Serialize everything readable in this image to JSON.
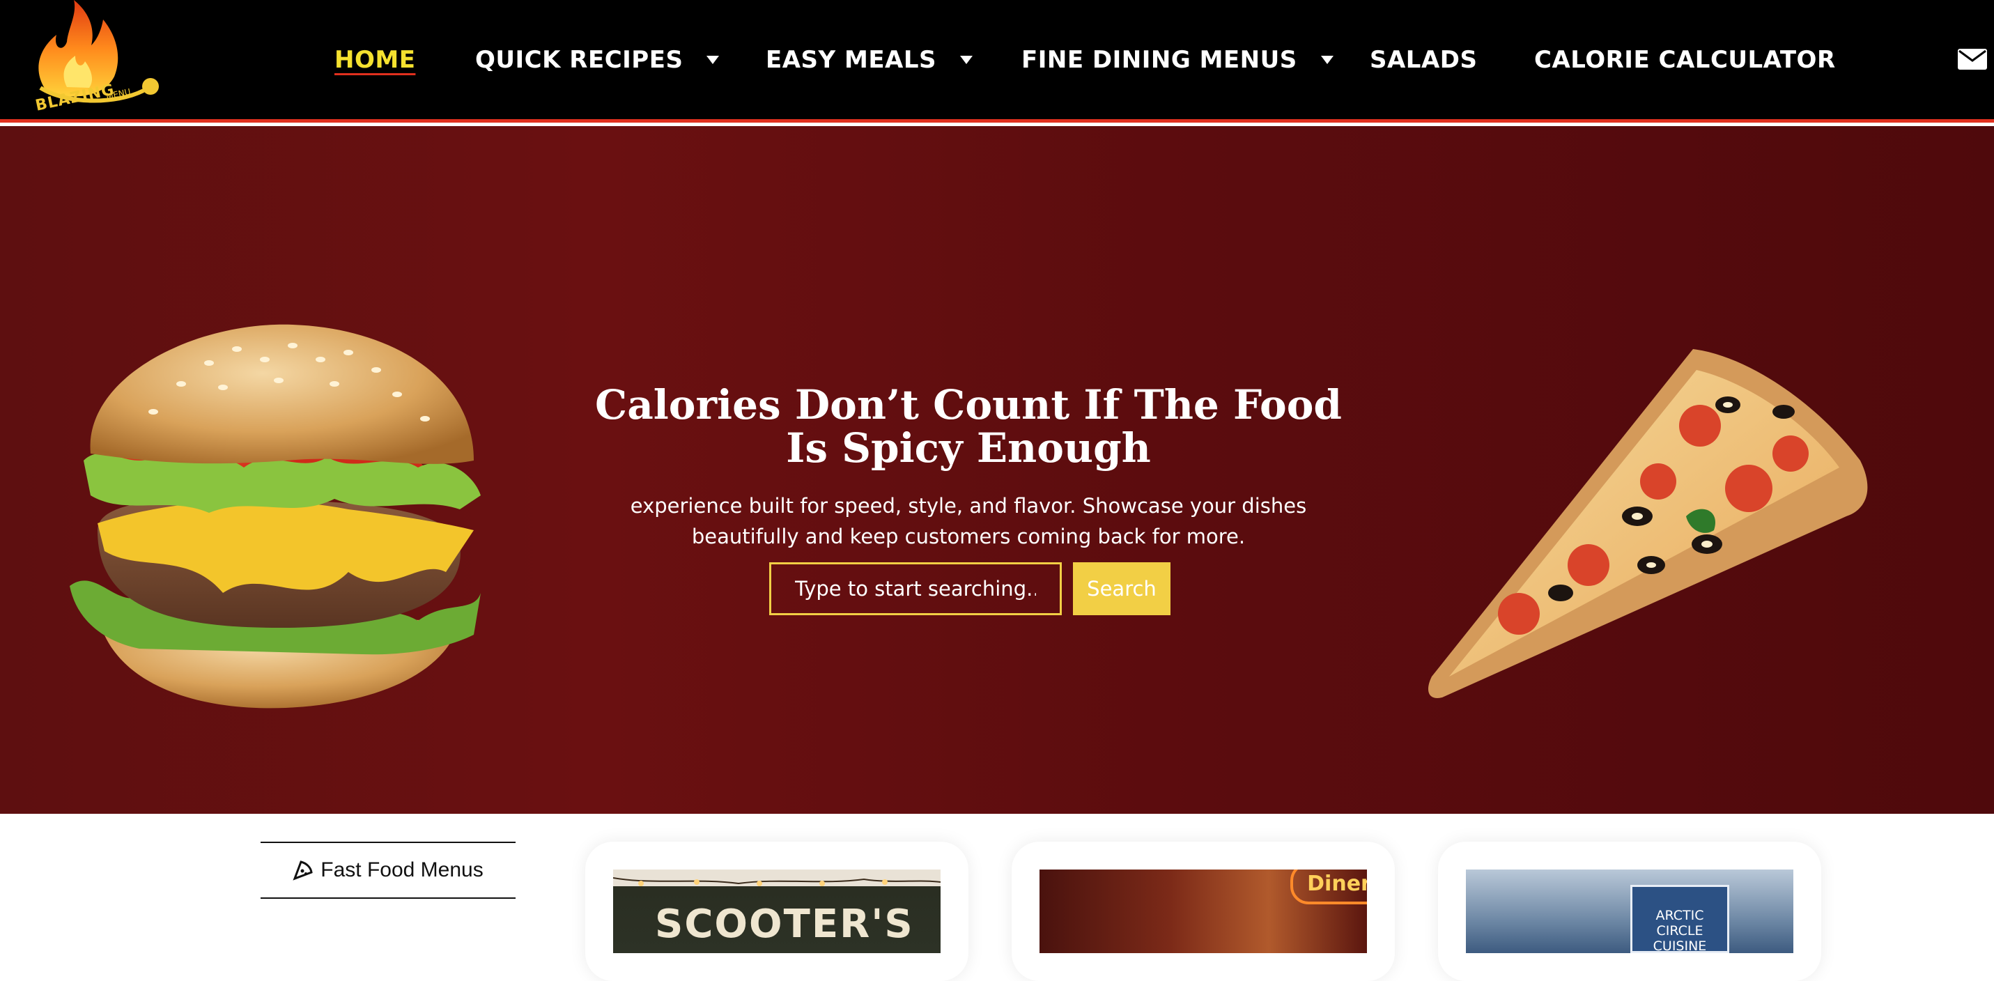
{
  "brand": {
    "logo_text": "BLAZING",
    "logo_sub": "MENU"
  },
  "nav": {
    "items": [
      {
        "label": "HOME",
        "active": true,
        "dropdown": false
      },
      {
        "label": "QUICK RECIPES",
        "active": false,
        "dropdown": true
      },
      {
        "label": "EASY MEALS",
        "active": false,
        "dropdown": true
      },
      {
        "label": "FINE DINING MENUS",
        "active": false,
        "dropdown": true
      },
      {
        "label": "SALADS",
        "active": false,
        "dropdown": false
      },
      {
        "label": "CALORIE CALCULATOR",
        "active": false,
        "dropdown": false
      }
    ],
    "mail_icon": "envelope-icon"
  },
  "hero": {
    "title": "Calories Don’t Count If The Food Is Spicy Enough",
    "text": "experience built for speed, style, and flavor. Showcase your dishes beautifully and keep customers coming back for more.",
    "search_placeholder": "Type to start searching...",
    "search_button": "Search"
  },
  "sections": {
    "category_label": "Fast Food Menus",
    "category_icon": "pizza-slice-icon",
    "cards": [
      {
        "sign": "SCOOTER'S CAFE"
      },
      {
        "sign": "Diner"
      },
      {
        "sign": "ARCTIC CIRCLE CUISINE"
      }
    ]
  },
  "colors": {
    "header_bg": "#000000",
    "accent_red": "#e0301e",
    "hero_bg": "#5e0f10",
    "active_nav": "#f5e12f",
    "search_accent": "#f2cf45"
  }
}
